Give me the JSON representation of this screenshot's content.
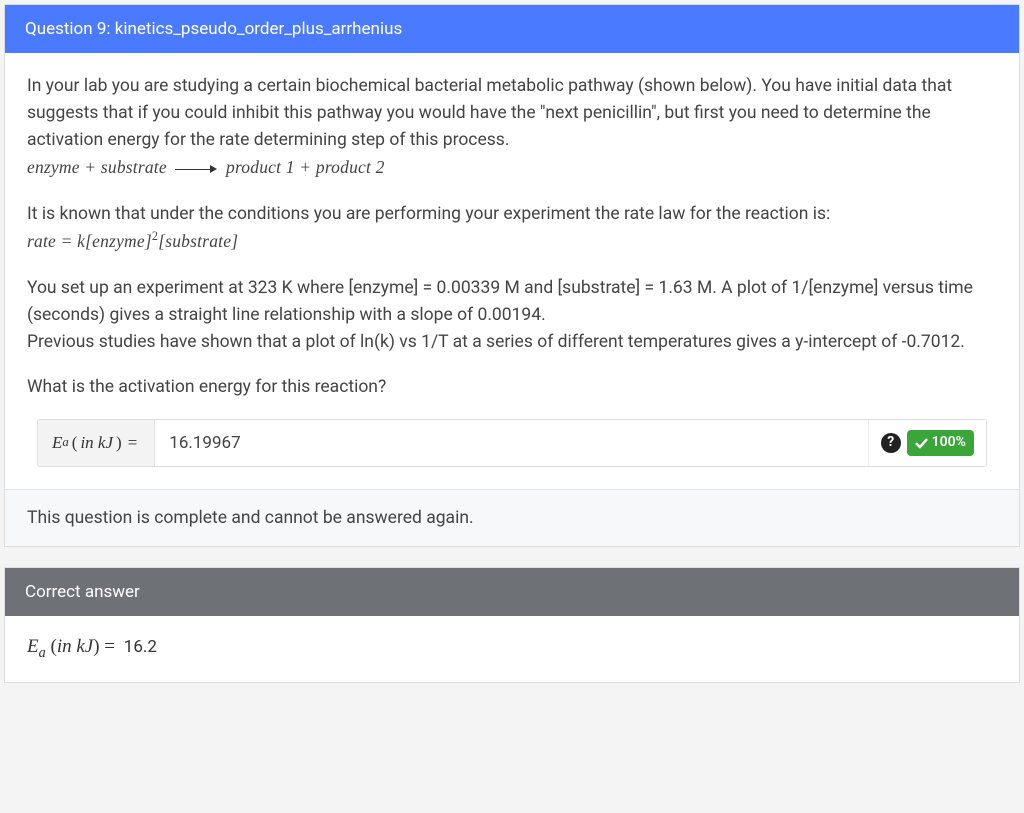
{
  "question": {
    "header": "Question 9: kinetics_pseudo_order_plus_arrhenius",
    "p1": "In your lab you are studying a certain biochemical bacterial metabolic pathway (shown below). You have initial data that suggests that if you could inhibit this pathway you would have the \"next penicillin\", but first you need to determine the activation energy for the rate determining step of this process.",
    "rxn_lhs": "enzyme + substrate",
    "rxn_rhs1": "product 1 + product 2",
    "p2": "It is known that under the conditions you are performing your experiment the rate law for the reaction is:",
    "rate_law_prefix": "rate = k",
    "rate_law_open1": "[",
    "rate_law_enz": "enzyme",
    "rate_law_close1": "]",
    "rate_law_exp": "2",
    "rate_law_open2": "[",
    "rate_law_sub": "substrate",
    "rate_law_close2": "]",
    "p3": "You set up an experiment at 323 K where [enzyme] = 0.00339 M and [substrate] = 1.63 M. A plot of 1/[enzyme] versus time (seconds) gives a straight line relationship with a slope of 0.00194.",
    "p3b": "Previous studies have shown that a plot of ln(k) vs 1/T at a series of different temperatures gives a y-intercept of -0.7012.",
    "prompt": "What is the activation energy for this reaction?"
  },
  "answer": {
    "label_E": "E",
    "label_sub": "a",
    "label_open": " (",
    "label_in": "in kJ",
    "label_close": ")",
    "label_eq": " = ",
    "value": "16.19967",
    "help_text": "?",
    "score_text": "100%"
  },
  "footer": "This question is complete and cannot be answered again.",
  "correct": {
    "header": "Correct answer",
    "value": "16.2"
  }
}
